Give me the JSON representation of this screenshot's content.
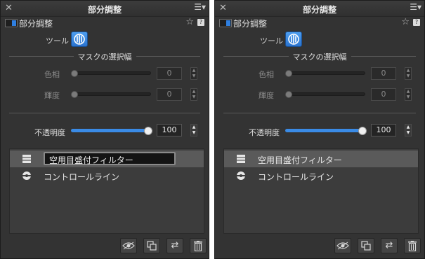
{
  "panels": [
    {
      "title": "部分調整",
      "section_title": "部分調整",
      "tool_label": "ツール",
      "mask_header": "マスクの選択幅",
      "hue_label": "色相",
      "hue_value": "0",
      "brightness_label": "輝度",
      "brightness_value": "0",
      "opacity_label": "不透明度",
      "opacity_value": "100",
      "opacity_level": 0.98,
      "items": [
        {
          "label": "空用目盛付フィルター",
          "icon": "graduated-filter-icon",
          "selected": true,
          "editing": true
        },
        {
          "label": "コントロールライン",
          "icon": "control-line-icon",
          "selected": false,
          "editing": false
        }
      ]
    },
    {
      "title": "部分調整",
      "section_title": "部分調整",
      "tool_label": "ツール",
      "mask_header": "マスクの選択幅",
      "hue_label": "色相",
      "hue_value": "0",
      "brightness_label": "輝度",
      "brightness_value": "0",
      "opacity_label": "不透明度",
      "opacity_value": "100",
      "opacity_level": 0.98,
      "items": [
        {
          "label": "空用目盛付フィルター",
          "icon": "graduated-filter-icon",
          "selected": true,
          "editing": false
        },
        {
          "label": "コントロールライン",
          "icon": "control-line-icon",
          "selected": false,
          "editing": false
        }
      ]
    }
  ],
  "icons": {
    "close": "close-icon",
    "menu": "menu-icon",
    "favorite": "star-icon",
    "help": "help-icon",
    "tool": "control-point-tool-icon",
    "show": "eye-icon",
    "duplicate": "duplicate-icon",
    "invert": "swap-icon",
    "delete": "trash-icon"
  },
  "colors": {
    "accent": "#3a8be6",
    "panel_bg": "#333333"
  }
}
